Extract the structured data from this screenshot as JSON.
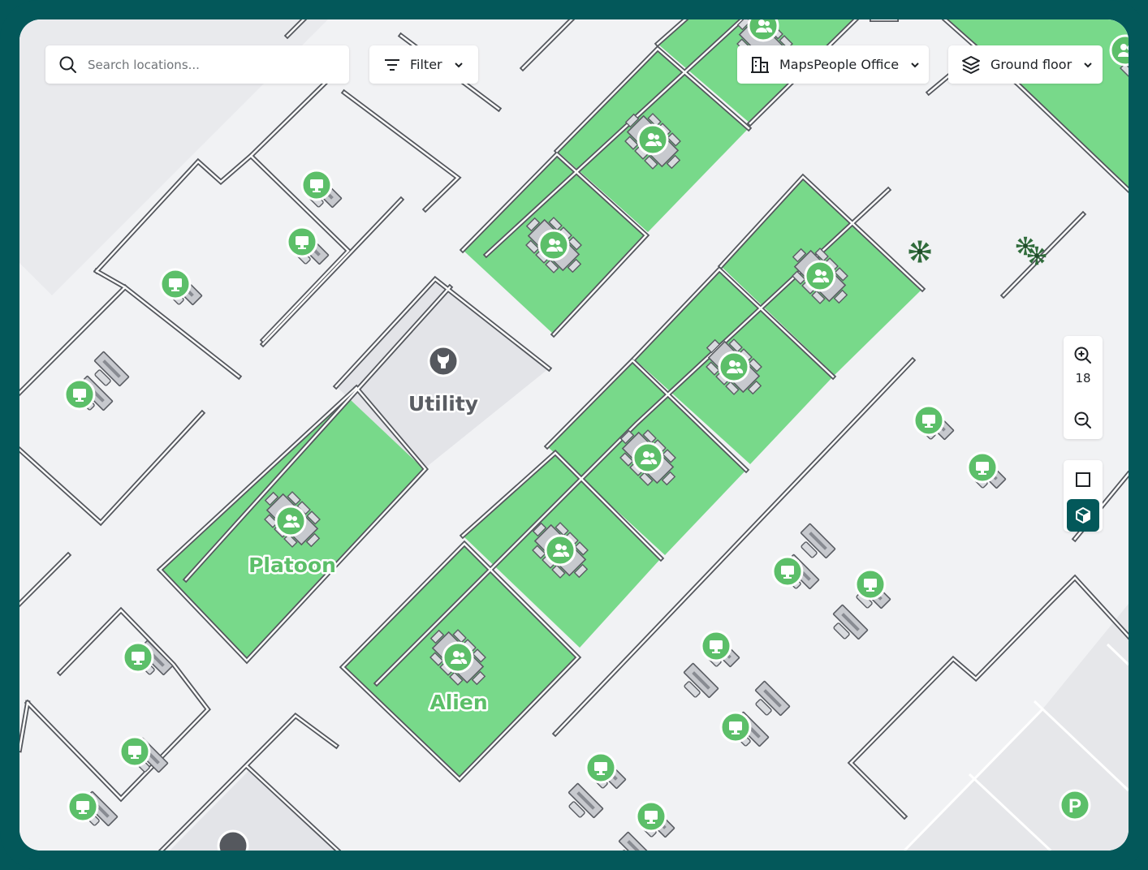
{
  "search": {
    "placeholder": "Search locations..."
  },
  "filter": {
    "label": "Filter"
  },
  "venue": {
    "label": "MapsPeople Office"
  },
  "floor": {
    "label": "Ground floor"
  },
  "zoom": {
    "level": "18"
  },
  "rooms": {
    "utility": "Utility",
    "platoon": "Platoon",
    "alien": "Alien"
  },
  "parking": {
    "glyph": "P"
  },
  "colors": {
    "frame": "#03585a",
    "meeting_room": "#78d98a",
    "marker": "#5cbf69",
    "utility_room": "#e3e4e8",
    "floor": "#f1f2f4"
  },
  "icons": [
    "search-icon",
    "filter-icon",
    "building-icon",
    "layers-icon",
    "chevron-down-icon",
    "zoom-in-icon",
    "zoom-out-icon",
    "2d-mode-icon",
    "3d-mode-icon",
    "meeting-room-icon",
    "workstation-icon",
    "utility-icon",
    "parking-icon",
    "plant-icon"
  ]
}
